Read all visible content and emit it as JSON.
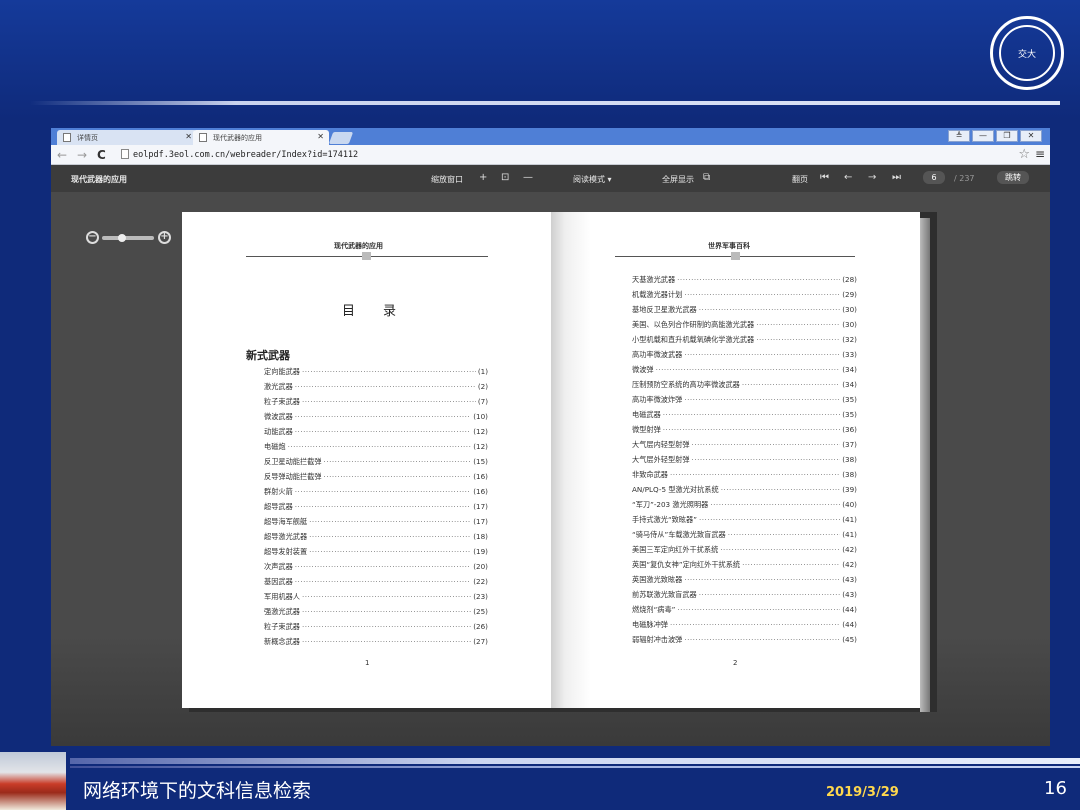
{
  "browser": {
    "tabs": [
      {
        "label": "详情页"
      },
      {
        "label": "现代武器的应用"
      }
    ],
    "url": "eolpdf.3eol.com.cn/webreader/Index?id=174112",
    "window_controls": [
      "≜",
      "—",
      "❐",
      "✕"
    ]
  },
  "reader": {
    "title": "现代武器的应用",
    "zoom_window_label": "缩放窗口",
    "zoom_in": "+",
    "fit": "⊡",
    "zoom_out": "—",
    "read_mode_label": "阅读模式 ▾",
    "fullscreen_label": "全屏显示",
    "flip_label": "翻页",
    "current_page": "6",
    "total_pages": "/ 237",
    "go_label": "跳转"
  },
  "left_page": {
    "running_head": "现代武器的应用",
    "toc_title": "目录",
    "section_title": "新式武器",
    "items": [
      {
        "t": "定向能武器",
        "p": "(1)"
      },
      {
        "t": "激光武器",
        "p": "(2)"
      },
      {
        "t": "粒子束武器",
        "p": "(7)"
      },
      {
        "t": "微波武器",
        "p": "(10)"
      },
      {
        "t": "动能武器",
        "p": "(12)"
      },
      {
        "t": "电磁炮",
        "p": "(12)"
      },
      {
        "t": "反卫星动能拦截弹",
        "p": "(15)"
      },
      {
        "t": "反导弹动能拦截弹",
        "p": "(16)"
      },
      {
        "t": "群射火箭",
        "p": "(16)"
      },
      {
        "t": "超导武器",
        "p": "(17)"
      },
      {
        "t": "超导海军舰艇",
        "p": "(17)"
      },
      {
        "t": "超导激光武器",
        "p": "(18)"
      },
      {
        "t": "超导发射装置",
        "p": "(19)"
      },
      {
        "t": "次声武器",
        "p": "(20)"
      },
      {
        "t": "基因武器",
        "p": "(22)"
      },
      {
        "t": "军用机器人",
        "p": "(23)"
      },
      {
        "t": "强激光武器",
        "p": "(25)"
      },
      {
        "t": "粒子束武器",
        "p": "(26)"
      },
      {
        "t": "新概念武器",
        "p": "(27)"
      }
    ],
    "page_number": "1"
  },
  "right_page": {
    "running_head": "世界军事百科",
    "items": [
      {
        "t": "天基激光武器",
        "p": "(28)"
      },
      {
        "t": "机载激光器计划",
        "p": "(29)"
      },
      {
        "t": "基地反卫星激光武器",
        "p": "(30)"
      },
      {
        "t": "美国、以色列合作研制的高能激光武器",
        "p": "(30)"
      },
      {
        "t": "小型机载和直升机载氧碘化学激光武器",
        "p": "(32)"
      },
      {
        "t": "高功率微波武器",
        "p": "(33)"
      },
      {
        "t": "微波弹",
        "p": "(34)"
      },
      {
        "t": "压制预防空系统的高功率微波武器",
        "p": "(34)"
      },
      {
        "t": "高功率微波炸弹",
        "p": "(35)"
      },
      {
        "t": "电磁武器",
        "p": "(35)"
      },
      {
        "t": "微型射弹",
        "p": "(36)"
      },
      {
        "t": "大气层内轻型射弹",
        "p": "(37)"
      },
      {
        "t": "大气层外轻型射弹",
        "p": "(38)"
      },
      {
        "t": "非致命武器",
        "p": "(38)"
      },
      {
        "t": "AN/PLQ-5 型激光对抗系统",
        "p": "(39)"
      },
      {
        "t": "“军刀”-203 激光照明器",
        "p": "(40)"
      },
      {
        "t": "手持式激光“致眩器”",
        "p": "(41)"
      },
      {
        "t": "“骑马侍从”车载激光致盲武器",
        "p": "(41)"
      },
      {
        "t": "美国三军定向红外干扰系统",
        "p": "(42)"
      },
      {
        "t": "英国“复仇女神”定向红外干扰系统",
        "p": "(42)"
      },
      {
        "t": "英国激光致眩器",
        "p": "(43)"
      },
      {
        "t": "前苏联激光致盲武器",
        "p": "(43)"
      },
      {
        "t": "燃烧剂“病毒”",
        "p": "(44)"
      },
      {
        "t": "电磁脉冲弹",
        "p": "(44)"
      },
      {
        "t": "弱辐射冲击波弹",
        "p": "(45)"
      }
    ],
    "page_number": "2"
  },
  "footer": {
    "title": "网络环境下的文科信息检索",
    "date": "2019/3/29",
    "slide_number": "16"
  },
  "logo_text": "交大"
}
